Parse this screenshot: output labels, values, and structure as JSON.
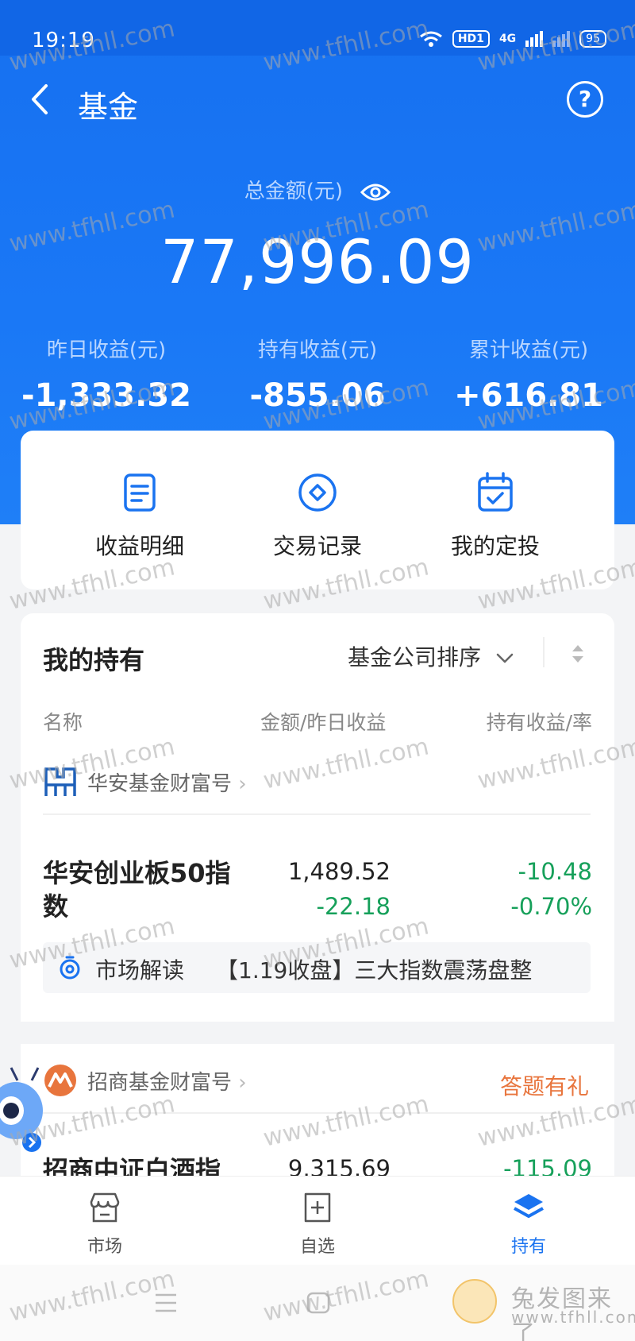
{
  "status": {
    "time": "19:19",
    "network": "HD1",
    "signal": "4G",
    "battery": "95"
  },
  "nav": {
    "title": "基金",
    "help": "?"
  },
  "summary": {
    "total_label": "总金额(元)",
    "total_amount": "77,996.09",
    "yesterday_label": "昨日收益(元)",
    "yesterday_value": "-1,333.32",
    "holding_label": "持有收益(元)",
    "holding_value": "-855.06",
    "cumulative_label": "累计收益(元)",
    "cumulative_value": "+616.81"
  },
  "quick_actions": [
    {
      "label": "收益明细",
      "icon": "document-icon"
    },
    {
      "label": "交易记录",
      "icon": "diamond-circle-icon"
    },
    {
      "label": "我的定投",
      "icon": "calendar-check-icon"
    }
  ],
  "holdings": {
    "title": "我的持有",
    "sort_label": "基金公司排序",
    "columns": {
      "name": "名称",
      "amount": "金额/昨日收益",
      "profit": "持有收益/率"
    },
    "groups": [
      {
        "name": "华安基金财富号",
        "logo": "huaan-logo-icon",
        "fund": {
          "name": "华安创业板50指数",
          "amount": "1,489.52",
          "yesterday": "-22.18",
          "holding_profit": "-10.48",
          "holding_rate": "-0.70%"
        },
        "market_label": "市场解读",
        "market_text": "【1.19收盘】三大指数震荡盘整"
      },
      {
        "name": "招商基金财富号",
        "logo": "zhaoshang-logo-icon",
        "promo": "答题有礼",
        "fund": {
          "name": "招商中证白酒指",
          "amount": "9,315.69",
          "holding_profit": "-115.09"
        }
      }
    ]
  },
  "tabbar": [
    {
      "label": "市场",
      "icon": "market-icon"
    },
    {
      "label": "自选",
      "icon": "add-square-icon"
    },
    {
      "label": "持有",
      "icon": "layers-icon",
      "active": true
    }
  ],
  "watermark": {
    "text": "www.tfhll.com",
    "logo_text": "兔发图来了",
    "logo_sub": "www.tfhll.com"
  },
  "colors": {
    "primary": "#1a73f0",
    "loss": "#16a05a",
    "promo": "#e8753d"
  }
}
